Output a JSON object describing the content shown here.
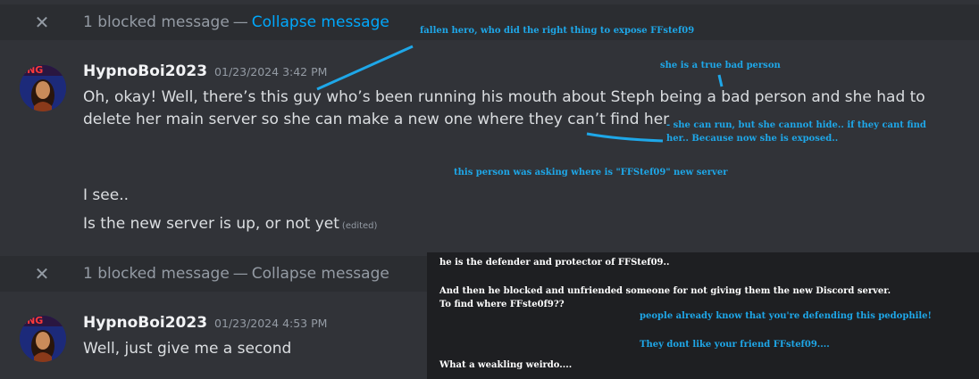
{
  "blocked_1": {
    "close_icon": "close-icon",
    "text": "1 blocked message",
    "dash": "—",
    "link": "Collapse message",
    "link_color": "#00a8fc"
  },
  "message_1": {
    "author": "HypnoBoi2023",
    "timestamp": "01/23/2024 3:42 PM",
    "line1": "Oh, okay! Well, there’s this guy who’s been running his mouth about Steph being a bad person and she had to",
    "line2": "delete her main server so she can make a new one where they can’t find her"
  },
  "message_2": {
    "text": "I see.."
  },
  "message_3": {
    "text": "Is the new server is up, or not yet",
    "edited": "(edited)"
  },
  "blocked_2": {
    "close_icon": "close-icon",
    "text": "1 blocked message",
    "dash": "—",
    "link": "Collapse message"
  },
  "message_4": {
    "author": "HypnoBoi2023",
    "timestamp": "01/23/2024 4:53 PM",
    "text": "Well, just give me a second"
  },
  "avatar_badge": "ING",
  "annotations": {
    "fallen_hero": "fallen hero, who did the right thing to expose FFstef09",
    "true_bad": "she is a true bad person",
    "can_run_1": "- she can run, but she cannot hide.. if they cant find",
    "can_run_2": "her.. Because now she is exposed..",
    "asking": "this person was asking where is \"FFStef09\" new server",
    "defender": "he is the defender and protector of FFStef09..",
    "blocked_1": "And then he blocked and unfriended someone for not giving them the new Discord server.",
    "blocked_2": "To find where FFste0f9??",
    "people_know": "people already know that you're defending this pedophile!",
    "dont_like": "They dont like your friend FFstef09....",
    "weakling": "What a weakling weirdo...."
  },
  "colors": {
    "annotation_blue": "#1ea7e8",
    "background": "#313338",
    "link": "#00a8fc"
  }
}
